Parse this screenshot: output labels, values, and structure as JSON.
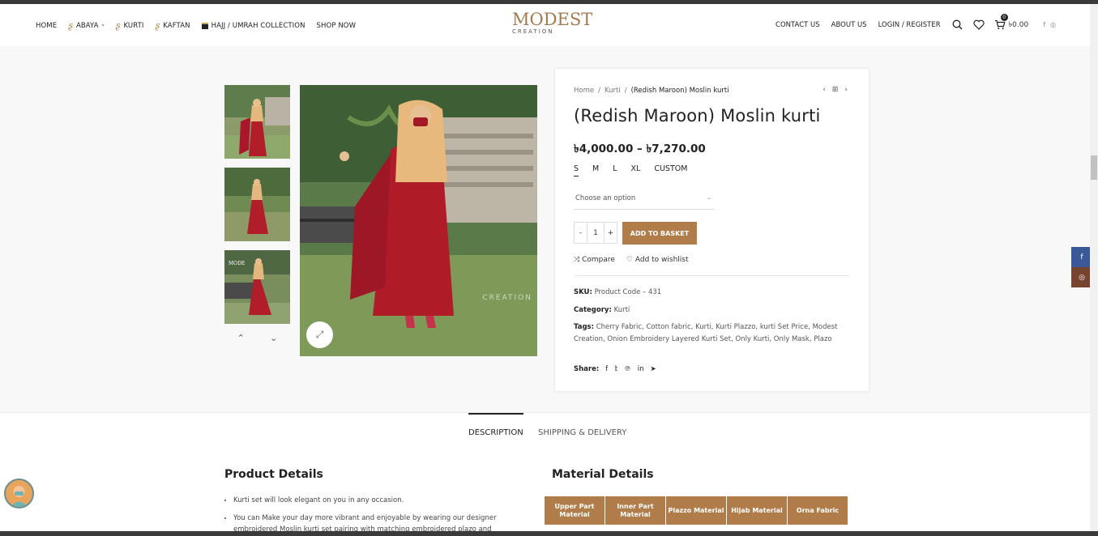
{
  "nav_left": [
    {
      "label": "HOME",
      "icon": "none"
    },
    {
      "label": "ABAYA",
      "icon": "s-ornament",
      "has_dropdown": true
    },
    {
      "label": "KURTI",
      "icon": "s-ornament"
    },
    {
      "label": "KAFTAN",
      "icon": "s-ornament"
    },
    {
      "label": "HAJJ / UMRAH COLLECTION",
      "icon": "kaaba"
    },
    {
      "label": "SHOP NOW",
      "icon": "none"
    }
  ],
  "logo": {
    "main": "MODEST",
    "sub": "CREATION"
  },
  "nav_right": {
    "contact": "CONTACT US",
    "about": "ABOUT US",
    "login": "LOGIN / REGISTER",
    "cart_count": "0",
    "cart_total": "৳0.00"
  },
  "breadcrumb": {
    "home": "Home",
    "sep": "/",
    "cat": "Kurti",
    "current": "(Redish Maroon) Moslin kurti"
  },
  "product": {
    "title": "(Redish Maroon) Moslin kurti",
    "price": "৳4,000.00 – ৳7,270.00",
    "sizes": [
      "S",
      "M",
      "L",
      "XL",
      "CUSTOM"
    ],
    "selected_size": "S",
    "select_placeholder": "Choose an option",
    "qty_minus": "-",
    "qty": "1",
    "qty_plus": "+",
    "add_label": "ADD TO BASKET",
    "compare": "Compare",
    "wishlist": "Add to wishlist",
    "sku_label": "SKU:",
    "sku": "Product Code – 431",
    "category_label": "Category:",
    "category": "Kurti",
    "tags_label": "Tags:",
    "tags": "Cherry Fabric, Cotton fabric, Kurti, Kurti Plazzo, kurti Set Price, Modest Creation, Onion Embroidery Layered Kurti Set, Only Kurti, Only Mask, Plazo",
    "share_label": "Share:",
    "watermark": "CREATION"
  },
  "tabs": {
    "description": "DESCRIPTION",
    "shipping": "SHIPPING & DELIVERY"
  },
  "product_details": {
    "title": "Product Details",
    "bullets": [
      "Kurti set will look elegant on you in any occasion.",
      "You can Make your day more vibrant and enjoyable by wearing our designer embroidered Moslin kurti set pairing with matching embroidered plazo and"
    ]
  },
  "material_details": {
    "title": "Material Details",
    "headers": [
      "Upper Part Material",
      "Inner Part Material",
      "Plazzo Material",
      "Hijab Material",
      "Orna Fabric"
    ]
  },
  "colors": {
    "accent": "#b07d4a",
    "facebook": "#3b5998",
    "instagram": "#774430"
  }
}
